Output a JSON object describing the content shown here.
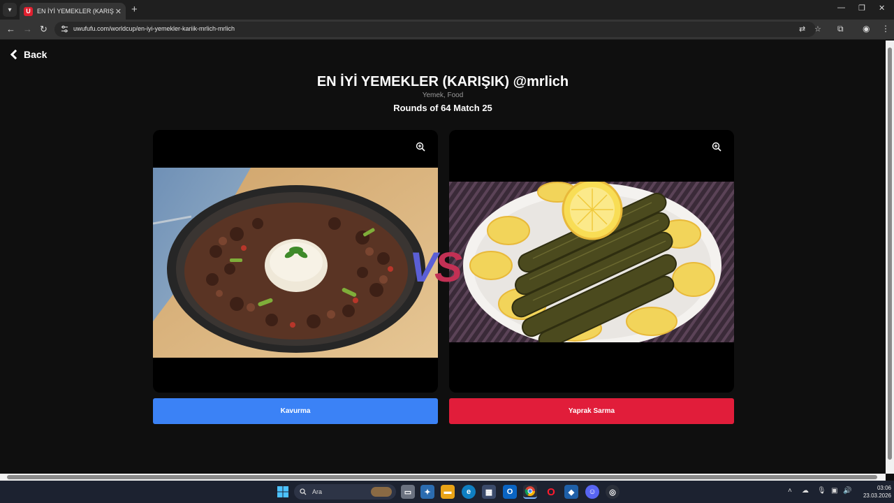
{
  "browser": {
    "tab_title": "EN İYİ YEMEKLER (KARIŞIK) @mrlich",
    "favicon_letter": "U",
    "url": "uwufufu.com/worldcup/en-iyi-yemekler-kariik-mrlich-mrlich"
  },
  "page": {
    "back_label": "Back",
    "title": "EN İYİ YEMEKLER (KARIŞIK) @mrlich",
    "subtitle": "Yemek, Food",
    "round_info": "Rounds of 64 Match 25",
    "vs_v": "V",
    "vs_s": "S"
  },
  "choices": [
    {
      "label": "Kavurma",
      "color": "#3b82f6"
    },
    {
      "label": "Yaprak Sarma",
      "color": "#e11d3a"
    }
  ],
  "taskbar": {
    "search_placeholder": "Ara",
    "time": "03:06",
    "date": "23.03.2026"
  },
  "colors": {
    "page_bg": "#0f0f0f",
    "vs_v": "#5b5fd6",
    "vs_s": "#c23054"
  }
}
